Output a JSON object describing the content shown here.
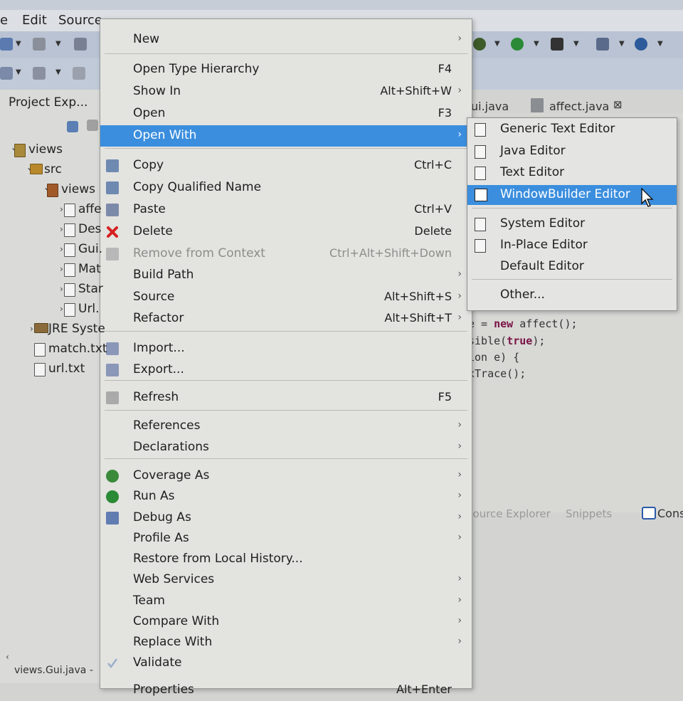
{
  "menubar": {
    "items": [
      "e",
      "Edit",
      "Source"
    ]
  },
  "project_explorer": {
    "tab_label": "Project Exp...",
    "tree": [
      {
        "label": "views",
        "indent": 0
      },
      {
        "label": "src",
        "indent": 1
      },
      {
        "label": "views",
        "indent": 2
      },
      {
        "label": "affe",
        "indent": 3
      },
      {
        "label": "Des",
        "indent": 3
      },
      {
        "label": "Gui.",
        "indent": 3
      },
      {
        "label": "Mat",
        "indent": 3
      },
      {
        "label": "Star",
        "indent": 3
      },
      {
        "label": "Url.",
        "indent": 3
      },
      {
        "label": "JRE Syste",
        "indent": 1
      },
      {
        "label": "match.txt",
        "indent": 1
      },
      {
        "label": "url.txt",
        "indent": 1
      }
    ],
    "status_label": "views.Gui.java -"
  },
  "editor": {
    "tabs": [
      "ui.java",
      "affect.java"
    ],
    "code_lines": [
      "e = new affect();",
      "sible(true);",
      "ion e) {",
      "xTrace();"
    ],
    "bottom_tabs": [
      "Source Explorer",
      "Snippets",
      "Cons"
    ]
  },
  "context_menu": {
    "items": [
      {
        "label": "New",
        "shortcut": "",
        "submenu": true
      },
      {
        "label": "Open Type Hierarchy",
        "shortcut": "F4",
        "submenu": false
      },
      {
        "label": "Show In",
        "shortcut": "Alt+Shift+W",
        "submenu": true
      },
      {
        "label": "Open",
        "shortcut": "F3",
        "submenu": false
      },
      {
        "label": "Open With",
        "shortcut": "",
        "submenu": true,
        "highlighted": true
      },
      {
        "label": "Copy",
        "shortcut": "Ctrl+C",
        "submenu": false
      },
      {
        "label": "Copy Qualified Name",
        "shortcut": "",
        "submenu": false
      },
      {
        "label": "Paste",
        "shortcut": "Ctrl+V",
        "submenu": false
      },
      {
        "label": "Delete",
        "shortcut": "Delete",
        "submenu": false
      },
      {
        "label": "Remove from Context",
        "shortcut": "Ctrl+Alt+Shift+Down",
        "submenu": false,
        "disabled": true
      },
      {
        "label": "Build Path",
        "shortcut": "",
        "submenu": true
      },
      {
        "label": "Source",
        "shortcut": "Alt+Shift+S",
        "submenu": true
      },
      {
        "label": "Refactor",
        "shortcut": "Alt+Shift+T",
        "submenu": true
      },
      {
        "label": "Import...",
        "shortcut": "",
        "submenu": false
      },
      {
        "label": "Export...",
        "shortcut": "",
        "submenu": false
      },
      {
        "label": "Refresh",
        "shortcut": "F5",
        "submenu": false
      },
      {
        "label": "References",
        "shortcut": "",
        "submenu": true
      },
      {
        "label": "Declarations",
        "shortcut": "",
        "submenu": true
      },
      {
        "label": "Coverage As",
        "shortcut": "",
        "submenu": true
      },
      {
        "label": "Run As",
        "shortcut": "",
        "submenu": true
      },
      {
        "label": "Debug As",
        "shortcut": "",
        "submenu": true
      },
      {
        "label": "Profile As",
        "shortcut": "",
        "submenu": true
      },
      {
        "label": "Restore from Local History...",
        "shortcut": "",
        "submenu": false
      },
      {
        "label": "Web Services",
        "shortcut": "",
        "submenu": true
      },
      {
        "label": "Team",
        "shortcut": "",
        "submenu": true
      },
      {
        "label": "Compare With",
        "shortcut": "",
        "submenu": true
      },
      {
        "label": "Replace With",
        "shortcut": "",
        "submenu": true
      },
      {
        "label": "Validate",
        "shortcut": "",
        "submenu": false
      },
      {
        "label": "Properties",
        "shortcut": "Alt+Enter",
        "submenu": false
      }
    ]
  },
  "open_with_submenu": {
    "items": [
      {
        "label": "Generic Text Editor"
      },
      {
        "label": "Java Editor"
      },
      {
        "label": "Text Editor"
      },
      {
        "label": "WindowBuilder Editor",
        "highlighted": true
      },
      {
        "label": "System Editor"
      },
      {
        "label": "In-Place Editor"
      },
      {
        "label": "Default Editor"
      },
      {
        "label": "Other..."
      }
    ]
  },
  "colors": {
    "highlight": "#3b8ede",
    "menu_bg": "#e3e3e0",
    "delete_icon": "#d62020"
  }
}
